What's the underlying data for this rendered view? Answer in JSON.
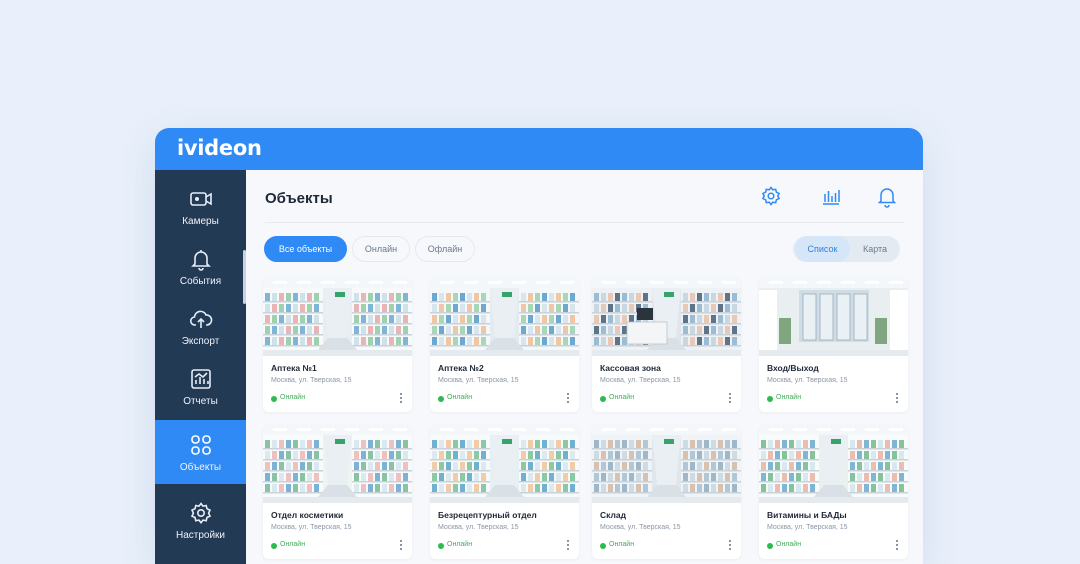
{
  "app": {
    "logo": "ivideon"
  },
  "sidebar": {
    "items": [
      {
        "label": "Камеры",
        "icon": "camera-icon",
        "active": false
      },
      {
        "label": "События",
        "icon": "bell-icon",
        "active": false
      },
      {
        "label": "Экспорт",
        "icon": "cloud-upload-icon",
        "active": false
      },
      {
        "label": "Отчеты",
        "icon": "report-chart-icon",
        "active": false
      },
      {
        "label": "Объекты",
        "icon": "objects-grid-icon",
        "active": true
      },
      {
        "label": "Настройки",
        "icon": "gear-icon",
        "active": false
      }
    ]
  },
  "header": {
    "title": "Объекты",
    "icons": [
      "settings-icon",
      "analytics-icon",
      "notifications-icon"
    ]
  },
  "filters": {
    "tabs": [
      {
        "label": "Все объекты",
        "active": true
      },
      {
        "label": "Онлайн",
        "active": false
      },
      {
        "label": "Офлайн",
        "active": false
      }
    ],
    "view": [
      {
        "label": "Список",
        "active": true
      },
      {
        "label": "Карта",
        "active": false
      }
    ]
  },
  "cards": [
    {
      "title": "Аптека №1",
      "address": "Москва, ул. Тверская, 15",
      "status": "Онлайн"
    },
    {
      "title": "Аптека №2",
      "address": "Москва, ул. Тверская, 15",
      "status": "Онлайн"
    },
    {
      "title": "Кассовая зона",
      "address": "Москва, ул. Тверская, 15",
      "status": "Онлайн"
    },
    {
      "title": "Вход/Выход",
      "address": "Москва, ул. Тверская, 15",
      "status": "Онлайн"
    },
    {
      "title": "Отдел косметики",
      "address": "Москва, ул. Тверская, 15",
      "status": "Онлайн"
    },
    {
      "title": "Безрецептурный отдел",
      "address": "Москва, ул. Тверская, 15",
      "status": "Онлайн"
    },
    {
      "title": "Склад",
      "address": "Москва, ул. Тверская, 15",
      "status": "Онлайн"
    },
    {
      "title": "Витамины и БАДы",
      "address": "Москва, ул. Тверская, 15",
      "status": "Онлайн"
    }
  ],
  "colors": {
    "accent": "#2f8af5",
    "sidebar": "#233a55",
    "online": "#2dba4e",
    "background": "#e9f0fb"
  }
}
